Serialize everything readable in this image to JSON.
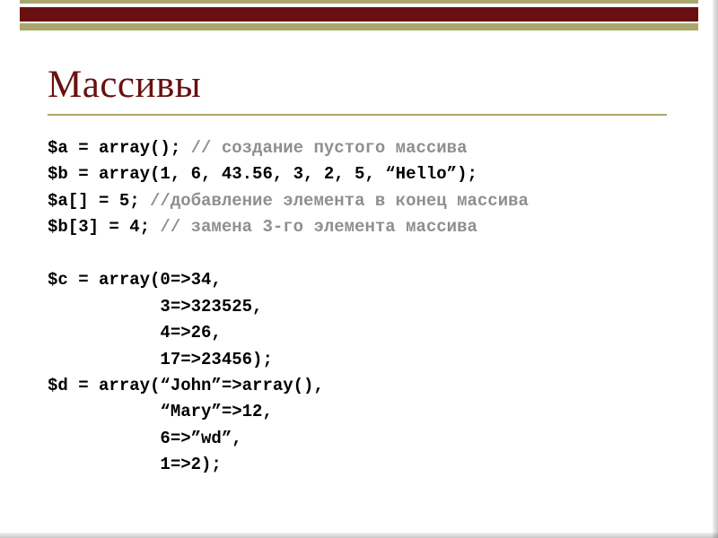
{
  "heading": "Массивы",
  "code": {
    "l1a": "$a = array(); ",
    "l1b": "// создание пустого массива",
    "l2": "$b = array(1, 6, 43.56, 3, 2, 5, “Hello”);",
    "l3a": "$a[] = 5; ",
    "l3b": "//добавление элемента в конец массива",
    "l4a": "$b[3] = 4; ",
    "l4b": "// замена 3-го элемента массива",
    "l5": "",
    "l6": "$c = array(0=>34,",
    "l7": "           3=>323525,",
    "l8": "           4=>26,",
    "l9": "           17=>23456);",
    "l10": "$d = array(“John”=>array(),",
    "l11": "           “Mary”=>12,",
    "l12": "           6=>”wd”,",
    "l13": "           1=>2);"
  }
}
